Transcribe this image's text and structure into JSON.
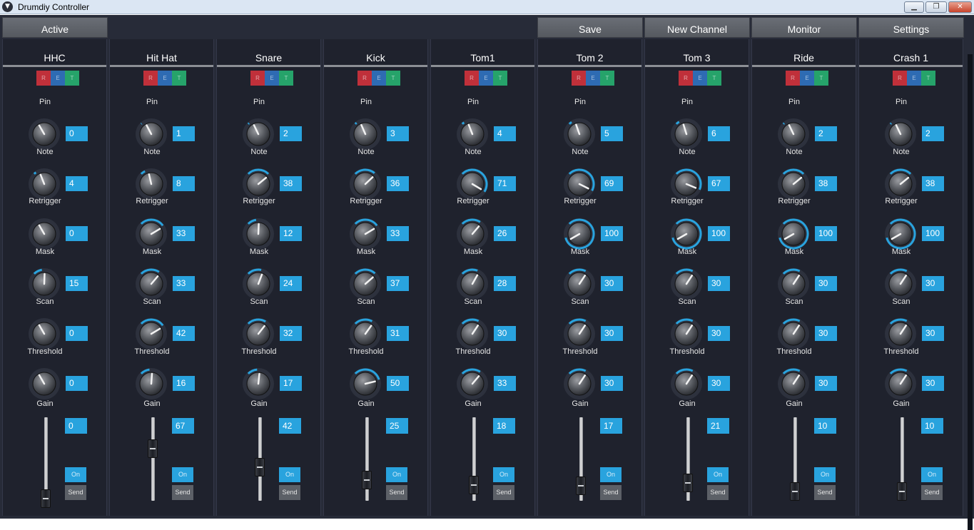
{
  "window": {
    "title": "Drumdiy Controller",
    "icon": "app-logo-icon",
    "controls": [
      "minimize-icon",
      "maximize-icon",
      "close-icon"
    ]
  },
  "toolbar": {
    "active_label": "Active",
    "save_label": "Save",
    "new_channel_label": "New Channel",
    "monitor_label": "Monitor",
    "settings_label": "Settings"
  },
  "colors": {
    "accent": "#29a3de",
    "panel": "#1f222d",
    "background": "#272b38",
    "button": "#5e6269",
    "rgb_r": "#c0303a",
    "rgb_g": "#2e6bb3",
    "rgb_b": "#26a36a"
  },
  "rgb_labels": [
    "R",
    "E",
    "T"
  ],
  "param_labels": [
    "Pin",
    "Note",
    "Retrigger",
    "Mask",
    "Scan",
    "Threshold"
  ],
  "gain_label": "Gain",
  "on_label": "On",
  "send_label": "Send",
  "channels": [
    {
      "name": "HHC",
      "params": [
        0,
        4,
        0,
        15,
        0,
        0
      ],
      "gain": 0
    },
    {
      "name": "Hit Hat",
      "params": [
        1,
        8,
        33,
        33,
        42,
        16
      ],
      "gain": 67
    },
    {
      "name": "Snare",
      "params": [
        2,
        38,
        12,
        24,
        32,
        17
      ],
      "gain": 42
    },
    {
      "name": "Kick",
      "params": [
        3,
        36,
        33,
        37,
        31,
        50
      ],
      "gain": 25
    },
    {
      "name": "Tom1",
      "params": [
        4,
        71,
        26,
        28,
        30,
        33
      ],
      "gain": 18
    },
    {
      "name": "Tom 2",
      "params": [
        5,
        69,
        100,
        30,
        30,
        30
      ],
      "gain": 17
    },
    {
      "name": "Tom 3",
      "params": [
        6,
        67,
        100,
        30,
        30,
        30
      ],
      "gain": 21
    },
    {
      "name": "Ride",
      "params": [
        2,
        38,
        100,
        30,
        30,
        30
      ],
      "gain": 10
    },
    {
      "name": "Crash 1",
      "params": [
        2,
        38,
        100,
        30,
        30,
        30
      ],
      "gain": 10
    }
  ]
}
